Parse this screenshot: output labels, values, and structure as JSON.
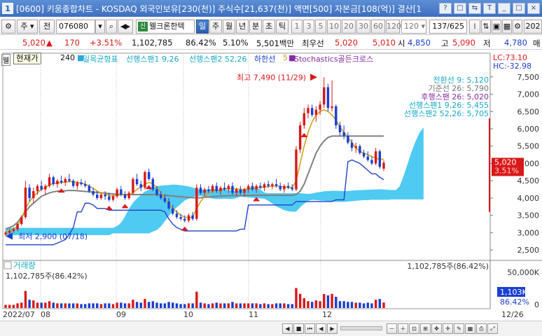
{
  "window": {
    "app_icon": "1",
    "title": "[0600] 키움종합차트 - KOSDAQ 외국인보유[230(천)] 주식수[21,637(천)] 액면[500] 자본금[108(억)] 결산[1",
    "buttons": [
      "?",
      "□",
      "⇆",
      "T",
      "_",
      "□",
      "×"
    ]
  },
  "toolbar": {
    "chart_type": "주",
    "market_type": "전",
    "stock_code": "076080",
    "indicator_mark": "신",
    "stock_name": "웰크론한텍",
    "period_tabs": [
      "일",
      "주",
      "월",
      "년",
      "분",
      "초",
      "틱"
    ],
    "active_period": "일",
    "intervals": [
      "1",
      "3",
      "5",
      "10",
      "20",
      "30",
      "60",
      "120"
    ],
    "interval_select": "120",
    "page_count": "137/625",
    "year_label": "202"
  },
  "quote": {
    "price": "5,020",
    "change": "170",
    "change_pct": "+3.51%",
    "volume": "1,102,785",
    "vol_ratio": "86.42%",
    "rate": "5.10%",
    "amount": "5,501백만",
    "pref_label": "최우선",
    "pref_sell": "5,020",
    "pref_buy": "5,010",
    "open_label": "시",
    "open": "4,850",
    "high_label": "고",
    "high": "5,090",
    "low_label": "저",
    "low": "4,780",
    "right_tab": "매"
  },
  "legend": {
    "checkbox": "웰",
    "tooltip": "현재가",
    "price_mark": "240",
    "ichimoku": "일목균형표",
    "span1": "선행스팬1 9,26",
    "span2": "선행스팬2 52,26",
    "lower": "하한선",
    "stoch_num": "5",
    "stochastics": "Stochastics골든크로스"
  },
  "lchc": {
    "lc": "LC:73.10",
    "hc": "HC:-32.98"
  },
  "ichimoku_values": {
    "conv": "전환선 9: 5,120",
    "base": "기준선 26: 5,790",
    "lag": "후행스팬 26: 5,020",
    "s1": "선행스팬1 9,26: 5,455",
    "s2": "선행스팬2 52,26: 5,705"
  },
  "price_axis": [
    "7,500",
    "7,000",
    "6,500",
    "6,000",
    "5,500",
    "5,000",
    "4,500",
    "4,000",
    "3,500",
    "3,000",
    "2,500"
  ],
  "price_badge": {
    "price": "5,020",
    "pct": "3.51%"
  },
  "annotations": {
    "high": "최고 7,490 (11/29)",
    "low": "최저 2,900 (07/18)"
  },
  "volume_panel": {
    "title": "거래량",
    "left_value": "1,102,785주(86.42%)",
    "right_value": "1,102,785주(86.42%)",
    "axis": [
      "50,000K",
      "0"
    ],
    "badge": "1,103K",
    "badge_pct": "86.42%"
  },
  "dates": [
    "2022/07",
    "08",
    "09",
    "10",
    "11",
    "12",
    "12/26"
  ],
  "colors": {
    "up": "#d91818",
    "down": "#1a3fd1",
    "cloud": "#3cc4ef",
    "titlebar": "#3d6fbf"
  },
  "chart_data": {
    "type": "candlestick",
    "title": "",
    "ylabel": "",
    "ylim": [
      2200,
      7900
    ],
    "volume_ylim": [
      0,
      50000000
    ],
    "candles": [
      {
        "o": 2950,
        "h": 3050,
        "l": 2900,
        "c": 3000
      },
      {
        "o": 3000,
        "h": 3100,
        "l": 2950,
        "c": 3050
      },
      {
        "o": 3050,
        "h": 3150,
        "l": 3000,
        "c": 3100
      },
      {
        "o": 3100,
        "h": 3300,
        "l": 3050,
        "c": 3250
      },
      {
        "o": 3250,
        "h": 3500,
        "l": 3200,
        "c": 3450
      },
      {
        "o": 3450,
        "h": 4500,
        "l": 3400,
        "c": 4300
      },
      {
        "o": 4300,
        "h": 4400,
        "l": 3900,
        "c": 4000
      },
      {
        "o": 4000,
        "h": 4300,
        "l": 3850,
        "c": 4200
      },
      {
        "o": 4200,
        "h": 4400,
        "l": 4100,
        "c": 4350
      },
      {
        "o": 4350,
        "h": 4500,
        "l": 4200,
        "c": 4250
      },
      {
        "o": 4250,
        "h": 4400,
        "l": 4100,
        "c": 4350
      },
      {
        "o": 4350,
        "h": 4700,
        "l": 4300,
        "c": 4600
      },
      {
        "o": 4600,
        "h": 4650,
        "l": 4350,
        "c": 4400
      },
      {
        "o": 4400,
        "h": 4550,
        "l": 4300,
        "c": 4500
      },
      {
        "o": 4500,
        "h": 4650,
        "l": 4400,
        "c": 4450
      },
      {
        "o": 4450,
        "h": 4600,
        "l": 4350,
        "c": 4550
      },
      {
        "o": 4550,
        "h": 4700,
        "l": 4450,
        "c": 4500
      },
      {
        "o": 4500,
        "h": 4550,
        "l": 4300,
        "c": 4350
      },
      {
        "o": 4350,
        "h": 4500,
        "l": 4250,
        "c": 4450
      },
      {
        "o": 4450,
        "h": 4550,
        "l": 4350,
        "c": 4400
      },
      {
        "o": 4400,
        "h": 4500,
        "l": 4300,
        "c": 4350
      },
      {
        "o": 4350,
        "h": 4400,
        "l": 4150,
        "c": 4200
      },
      {
        "o": 4200,
        "h": 4300,
        "l": 4050,
        "c": 4100
      },
      {
        "o": 4100,
        "h": 4200,
        "l": 3950,
        "c": 4000
      },
      {
        "o": 4000,
        "h": 4150,
        "l": 3950,
        "c": 4100
      },
      {
        "o": 4100,
        "h": 4200,
        "l": 3950,
        "c": 4050
      },
      {
        "o": 4050,
        "h": 4150,
        "l": 3900,
        "c": 3950
      },
      {
        "o": 3950,
        "h": 4100,
        "l": 3900,
        "c": 4050
      },
      {
        "o": 4050,
        "h": 4300,
        "l": 4000,
        "c": 4250
      },
      {
        "o": 4250,
        "h": 4350,
        "l": 4050,
        "c": 4100
      },
      {
        "o": 4100,
        "h": 4200,
        "l": 3950,
        "c": 4000
      },
      {
        "o": 4000,
        "h": 4200,
        "l": 3950,
        "c": 4150
      },
      {
        "o": 4150,
        "h": 4600,
        "l": 4100,
        "c": 4550
      },
      {
        "o": 4550,
        "h": 4700,
        "l": 4350,
        "c": 4400
      },
      {
        "o": 4400,
        "h": 4500,
        "l": 4200,
        "c": 4300
      },
      {
        "o": 4300,
        "h": 4800,
        "l": 4250,
        "c": 4750
      },
      {
        "o": 4750,
        "h": 4850,
        "l": 4500,
        "c": 4550
      },
      {
        "o": 4550,
        "h": 4600,
        "l": 4200,
        "c": 4250
      },
      {
        "o": 4250,
        "h": 4350,
        "l": 4050,
        "c": 4100
      },
      {
        "o": 4100,
        "h": 4200,
        "l": 3950,
        "c": 4000
      },
      {
        "o": 4000,
        "h": 4100,
        "l": 3850,
        "c": 3900
      },
      {
        "o": 3900,
        "h": 4000,
        "l": 3650,
        "c": 3700
      },
      {
        "o": 3700,
        "h": 3800,
        "l": 3500,
        "c": 3550
      },
      {
        "o": 3550,
        "h": 3650,
        "l": 3400,
        "c": 3450
      },
      {
        "o": 3450,
        "h": 3550,
        "l": 3350,
        "c": 3400
      },
      {
        "o": 3400,
        "h": 3500,
        "l": 3300,
        "c": 3350
      },
      {
        "o": 3350,
        "h": 3550,
        "l": 3300,
        "c": 3500
      },
      {
        "o": 3500,
        "h": 3600,
        "l": 3350,
        "c": 3400
      },
      {
        "o": 3400,
        "h": 4400,
        "l": 3350,
        "c": 4300
      },
      {
        "o": 4300,
        "h": 4400,
        "l": 4100,
        "c": 4150
      },
      {
        "o": 4150,
        "h": 4300,
        "l": 4050,
        "c": 4250
      },
      {
        "o": 4250,
        "h": 4350,
        "l": 4150,
        "c": 4200
      },
      {
        "o": 4200,
        "h": 4400,
        "l": 4150,
        "c": 4350
      },
      {
        "o": 4350,
        "h": 4450,
        "l": 4150,
        "c": 4200
      },
      {
        "o": 4200,
        "h": 4350,
        "l": 4100,
        "c": 4300
      },
      {
        "o": 4300,
        "h": 4450,
        "l": 4200,
        "c": 4250
      },
      {
        "o": 4250,
        "h": 4400,
        "l": 4150,
        "c": 4350
      },
      {
        "o": 4350,
        "h": 4450,
        "l": 4100,
        "c": 4150
      },
      {
        "o": 4150,
        "h": 4300,
        "l": 4050,
        "c": 4250
      },
      {
        "o": 4250,
        "h": 4350,
        "l": 4100,
        "c": 4150
      },
      {
        "o": 4150,
        "h": 4300,
        "l": 4050,
        "c": 4250
      },
      {
        "o": 4250,
        "h": 4400,
        "l": 4150,
        "c": 4350
      },
      {
        "o": 4350,
        "h": 4450,
        "l": 4200,
        "c": 4250
      },
      {
        "o": 4250,
        "h": 4400,
        "l": 4150,
        "c": 4350
      },
      {
        "o": 4350,
        "h": 4450,
        "l": 4250,
        "c": 4300
      },
      {
        "o": 4300,
        "h": 4450,
        "l": 4200,
        "c": 4400
      },
      {
        "o": 4400,
        "h": 4500,
        "l": 4300,
        "c": 4350
      },
      {
        "o": 4350,
        "h": 4450,
        "l": 4250,
        "c": 4400
      },
      {
        "o": 4400,
        "h": 4550,
        "l": 4300,
        "c": 4350
      },
      {
        "o": 4350,
        "h": 4450,
        "l": 4200,
        "c": 4250
      },
      {
        "o": 4250,
        "h": 4400,
        "l": 4150,
        "c": 4350
      },
      {
        "o": 4350,
        "h": 4450,
        "l": 4250,
        "c": 4300
      },
      {
        "o": 4300,
        "h": 4400,
        "l": 4200,
        "c": 4250
      },
      {
        "o": 4250,
        "h": 5500,
        "l": 4200,
        "c": 5400
      },
      {
        "o": 5400,
        "h": 6200,
        "l": 5300,
        "c": 6100
      },
      {
        "o": 6100,
        "h": 6600,
        "l": 6000,
        "c": 6450
      },
      {
        "o": 6450,
        "h": 6700,
        "l": 6300,
        "c": 6600
      },
      {
        "o": 6600,
        "h": 6700,
        "l": 6350,
        "c": 6400
      },
      {
        "o": 6400,
        "h": 6650,
        "l": 6200,
        "c": 6550
      },
      {
        "o": 6550,
        "h": 6800,
        "l": 6400,
        "c": 6700
      },
      {
        "o": 6700,
        "h": 7490,
        "l": 6600,
        "c": 7200
      },
      {
        "o": 7200,
        "h": 7300,
        "l": 6500,
        "c": 6600
      },
      {
        "o": 6600,
        "h": 7400,
        "l": 6500,
        "c": 6650
      },
      {
        "o": 6650,
        "h": 6700,
        "l": 6000,
        "c": 6100
      },
      {
        "o": 6100,
        "h": 6200,
        "l": 5800,
        "c": 5900
      },
      {
        "o": 5900,
        "h": 6100,
        "l": 5700,
        "c": 5800
      },
      {
        "o": 5800,
        "h": 5900,
        "l": 5550,
        "c": 5600
      },
      {
        "o": 5600,
        "h": 5700,
        "l": 5350,
        "c": 5450
      },
      {
        "o": 5450,
        "h": 5600,
        "l": 5300,
        "c": 5500
      },
      {
        "o": 5500,
        "h": 5550,
        "l": 5250,
        "c": 5300
      },
      {
        "o": 5300,
        "h": 5400,
        "l": 5150,
        "c": 5200
      },
      {
        "o": 5200,
        "h": 5350,
        "l": 5050,
        "c": 5100
      },
      {
        "o": 5100,
        "h": 5200,
        "l": 4950,
        "c": 5000
      },
      {
        "o": 5000,
        "h": 5450,
        "l": 4950,
        "c": 5350
      },
      {
        "o": 5350,
        "h": 5400,
        "l": 4850,
        "c": 4900
      },
      {
        "o": 4850,
        "h": 5090,
        "l": 4780,
        "c": 5020
      }
    ],
    "conversion_line": [
      3000,
      3050,
      3100,
      3200,
      3400,
      3700,
      3900,
      4050,
      4150,
      4250,
      4300,
      4380,
      4420,
      4440,
      4450,
      4460,
      4480,
      4470,
      4450,
      4430,
      4400,
      4350,
      4280,
      4200,
      4150,
      4120,
      4080,
      4060,
      4080,
      4100,
      4090,
      4080,
      4150,
      4250,
      4320,
      4400,
      4450,
      4420,
      4300,
      4150,
      4000,
      3850,
      3700,
      3600,
      3500,
      3450,
      3430,
      3450,
      3700,
      3900,
      4050,
      4150,
      4200,
      4220,
      4250,
      4260,
      4270,
      4270,
      4260,
      4250,
      4250,
      4270,
      4290,
      4300,
      4310,
      4320,
      4330,
      4340,
      4350,
      4340,
      4320,
      4310,
      4300,
      4500,
      5000,
      5500,
      5900,
      6200,
      6400,
      6500,
      6550,
      6500,
      6400,
      6250,
      6050,
      5900,
      5750,
      5600,
      5450,
      5350,
      5300,
      5250,
      5200,
      5150,
      5120,
      5120
    ],
    "base_line": [
      3100,
      3150,
      3200,
      3300,
      3450,
      3600,
      3750,
      3850,
      3950,
      4050,
      4100,
      4150,
      4180,
      4200,
      4200,
      4210,
      4220,
      4220,
      4210,
      4200,
      4190,
      4180,
      4170,
      4160,
      4150,
      4140,
      4130,
      4120,
      4110,
      4100,
      4100,
      4100,
      4100,
      4100,
      4100,
      4100,
      4100,
      4100,
      4100,
      4090,
      4080,
      4070,
      4060,
      4050,
      4040,
      4030,
      4020,
      4010,
      4010,
      4010,
      4020,
      4030,
      4040,
      4050,
      4060,
      4060,
      4070,
      4070,
      4070,
      4070,
      4070,
      4080,
      4080,
      4080,
      4080,
      4080,
      4080,
      4080,
      4080,
      4080,
      4080,
      4080,
      4080,
      4100,
      4200,
      4400,
      4700,
      5000,
      5300,
      5500,
      5650,
      5750,
      5790,
      5790,
      5790,
      5790,
      5790,
      5790,
      5790,
      5790,
      5790,
      5790,
      5790,
      5790,
      5790,
      5790
    ]
  }
}
